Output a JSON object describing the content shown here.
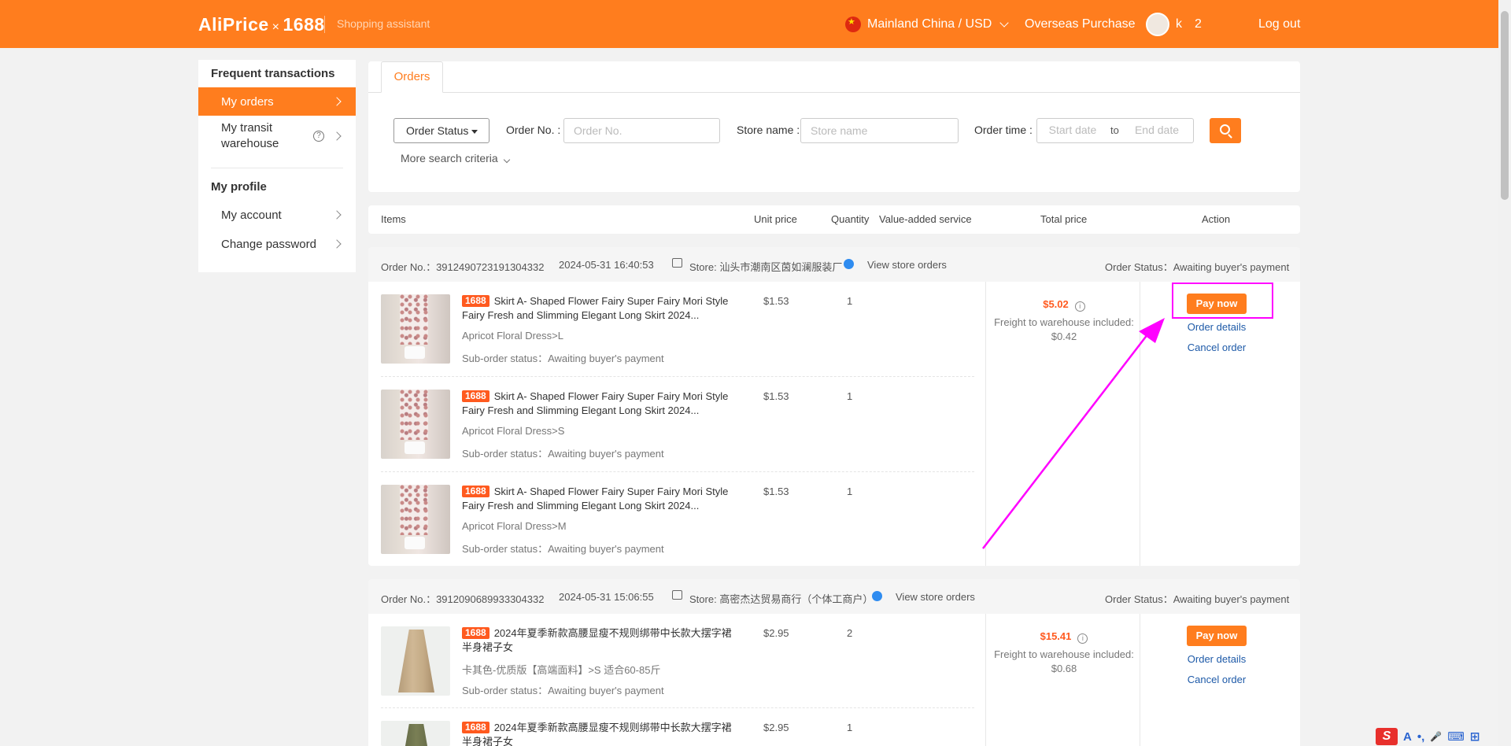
{
  "header": {
    "logo_left": "AliPrice",
    "logo_x": "×",
    "logo_right": "1688",
    "tagline": "Shopping assistant",
    "region": "Mainland China / USD",
    "overseas": "Overseas Purchase",
    "username": "k  2  ",
    "logout": "Log out"
  },
  "sidebar": {
    "heading_1": "Frequent transactions",
    "my_orders": "My orders",
    "transit_line1": "My transit",
    "transit_line2": "warehouse",
    "heading_2": "My profile",
    "my_account": "My account",
    "change_password": "Change password"
  },
  "tabs": {
    "orders": "Orders"
  },
  "filters": {
    "order_status": "Order Status",
    "order_no_label": "Order No. :",
    "order_no_placeholder": "Order No.",
    "store_label": "Store name :",
    "store_placeholder": "Store name",
    "time_label": "Order time :",
    "start_placeholder": "Start date",
    "to": "to",
    "end_placeholder": "End date",
    "more": "More search criteria"
  },
  "table_head": {
    "items": "Items",
    "unit_price": "Unit price",
    "quantity": "Quantity",
    "vas": "Value-added service",
    "total": "Total price",
    "action": "Action"
  },
  "orders": [
    {
      "no_label": "Order No.：",
      "no": "3912490723191304332",
      "date": "2024-05-31 16:40:53",
      "store_label": "Store:",
      "store": "汕头市潮南区茵如澜服装厂",
      "view_store": "View store orders",
      "status_label": "Order Status：",
      "status": "Awaiting buyer's payment",
      "total": "$5.02",
      "freight_label": "Freight to warehouse included:",
      "freight": "$0.42",
      "pay": "Pay now",
      "details": "Order details",
      "cancel": "Cancel order",
      "items": [
        {
          "badge": "1688",
          "title": "Skirt A- Shaped Flower Fairy Super Fairy Mori Style Fairy Fresh and Slimming Elegant Long Skirt 2024...",
          "variant": "Apricot Floral Dress>L",
          "sub_label": "Sub-order status：",
          "sub": "Awaiting buyer's payment",
          "unit": "$1.53",
          "qty": "1"
        },
        {
          "badge": "1688",
          "title": "Skirt A- Shaped Flower Fairy Super Fairy Mori Style Fairy Fresh and Slimming Elegant Long Skirt 2024...",
          "variant": "Apricot Floral Dress>S",
          "sub_label": "Sub-order status：",
          "sub": "Awaiting buyer's payment",
          "unit": "$1.53",
          "qty": "1"
        },
        {
          "badge": "1688",
          "title": "Skirt A- Shaped Flower Fairy Super Fairy Mori Style Fairy Fresh and Slimming Elegant Long Skirt 2024...",
          "variant": "Apricot Floral Dress>M",
          "sub_label": "Sub-order status：",
          "sub": "Awaiting buyer's payment",
          "unit": "$1.53",
          "qty": "1"
        }
      ]
    },
    {
      "no_label": "Order No.：",
      "no": "3912090689933304332",
      "date": "2024-05-31 15:06:55",
      "store_label": "Store:",
      "store": "高密杰达贸易商行（个体工商户）",
      "view_store": "View store orders",
      "status_label": "Order Status：",
      "status": "Awaiting buyer's payment",
      "total": "$15.41",
      "freight_label": "Freight to warehouse included:",
      "freight": "$0.68",
      "pay": "Pay now",
      "details": "Order details",
      "cancel": "Cancel order",
      "items": [
        {
          "badge": "1688",
          "title": "2024年夏季新款高腰显瘦不规则绑带中长款大摆字裙半身裙子女",
          "variant": "卡其色-优质版【高端面料】>S 适合60-85斤",
          "sub_label": "Sub-order status：",
          "sub": "Awaiting buyer's payment",
          "unit": "$2.95",
          "qty": "2"
        },
        {
          "badge": "1688",
          "title": "2024年夏季新款高腰显瘦不规则绑带中长款大摆字裙半身裙子女",
          "unit": "$2.95",
          "qty": "1"
        }
      ]
    }
  ],
  "ime": {
    "a": "A",
    "dots": "•,",
    "mic": "🎤",
    "kb": "⌨",
    "grid": "⊞"
  }
}
